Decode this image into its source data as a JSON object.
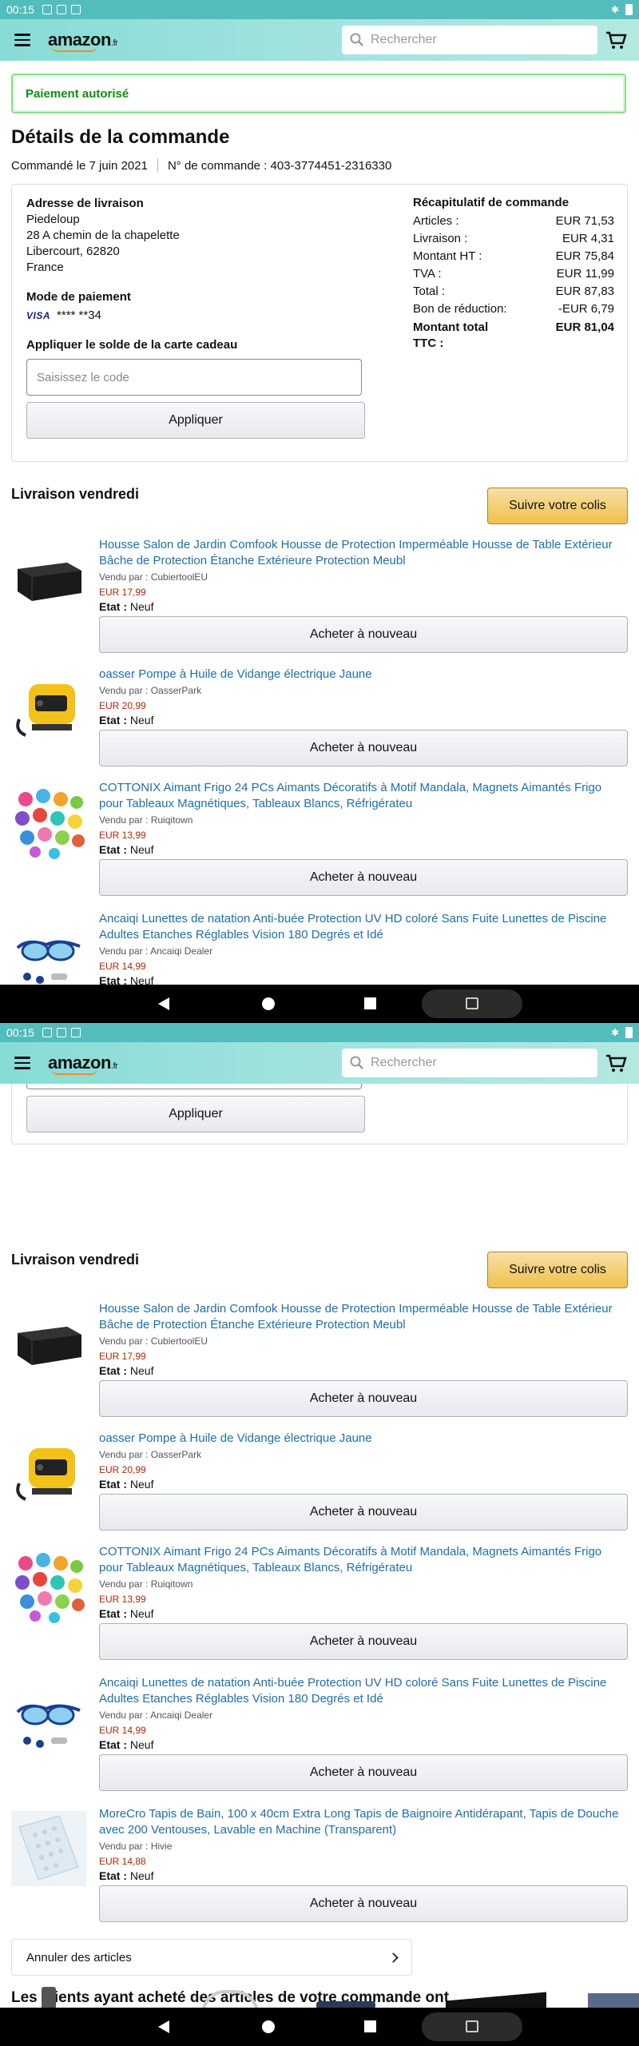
{
  "status_bar": {
    "time": "00:15"
  },
  "header": {
    "logo_text": "amazon",
    "logo_suffix": ".fr",
    "search_placeholder": "Rechercher"
  },
  "alert": "Paiement autorisé",
  "page_title": "Détails de la commande",
  "order_date": "Commandé le 7 juin 2021",
  "order_number": "N° de commande : 403-3774451-2316330",
  "shipping": {
    "title": "Adresse de livraison",
    "lines": [
      "Piedeloup",
      "28 A chemin de la chapelette",
      "Libercourt, 62820",
      "France"
    ]
  },
  "payment": {
    "title": "Mode de paiement",
    "card_brand": "VISA",
    "card_masked": "**** **34"
  },
  "gift_card": {
    "title": "Appliquer le solde de la carte cadeau",
    "placeholder": "Saisissez le code",
    "button": "Appliquer"
  },
  "summary": {
    "title": "Récapitulatif de commande",
    "rows": [
      {
        "label": "Articles :",
        "value": "EUR 71,53"
      },
      {
        "label": "Livraison :",
        "value": "EUR 4,31"
      },
      {
        "label": "Montant HT :",
        "value": "EUR 75,84"
      },
      {
        "label": "TVA :",
        "value": "EUR 11,99"
      },
      {
        "label": "Total :",
        "value": "EUR 87,83"
      },
      {
        "label": "Bon de réduction:",
        "value": "-EUR 6,79"
      }
    ],
    "grand_total_label": "Montant total TTC :",
    "grand_total_value": "EUR 81,04"
  },
  "delivery": {
    "title": "Livraison vendredi",
    "track_button": "Suivre votre colis"
  },
  "labels": {
    "sold_by": "Vendu par : ",
    "state": "Etat : ",
    "buy_again": "Acheter à nouveau"
  },
  "items": [
    {
      "title": "Housse Salon de Jardin Comfook Housse de Protection Imperméable Housse de Table Extérieur Bâche de Protection Étanche Extérieure Protection Meubl",
      "seller": "CubiertoolEU",
      "price": "EUR 17,99",
      "state": "Neuf"
    },
    {
      "title": "oasser Pompe à Huile de Vidange électrique Jaune",
      "seller": "OasserPark",
      "price": "EUR 20,99",
      "state": "Neuf"
    },
    {
      "title": "COTTONIX Aimant Frigo 24 PCs Aimants Décoratifs à Motif Mandala, Magnets Aimantés Frigo pour Tableaux Magnétiques, Tableaux Blancs, Réfrigérateu",
      "seller": "Ruiqitown",
      "price": "EUR 13,99",
      "state": "Neuf"
    },
    {
      "title": "Ancaiqi Lunettes de natation Anti-buée Protection UV HD coloré Sans Fuite Lunettes de Piscine Adultes Etanches Réglables Vision 180 Degrés et Idé",
      "seller": "Ancaiqi Dealer",
      "price": "EUR 14,99",
      "state": "Neuf"
    },
    {
      "title": "MoreCro Tapis de Bain, 100 x 40cm Extra Long Tapis de Baignoire Antidérapant, Tapis de Douche avec 200 Ventouses, Lavable en Machine (Transparent)",
      "seller": "Hivie",
      "price": "EUR 14,88",
      "state": "Neuf"
    }
  ],
  "cancel_items": "Annuler des articles",
  "recommendations_title": "Les clients ayant acheté des articles de votre commande ont également acheté",
  "icons": [
    "menu-icon",
    "search-icon",
    "cart-icon",
    "chevron-right-icon",
    "back-icon",
    "home-icon",
    "recents-icon",
    "keyboard-icon"
  ]
}
